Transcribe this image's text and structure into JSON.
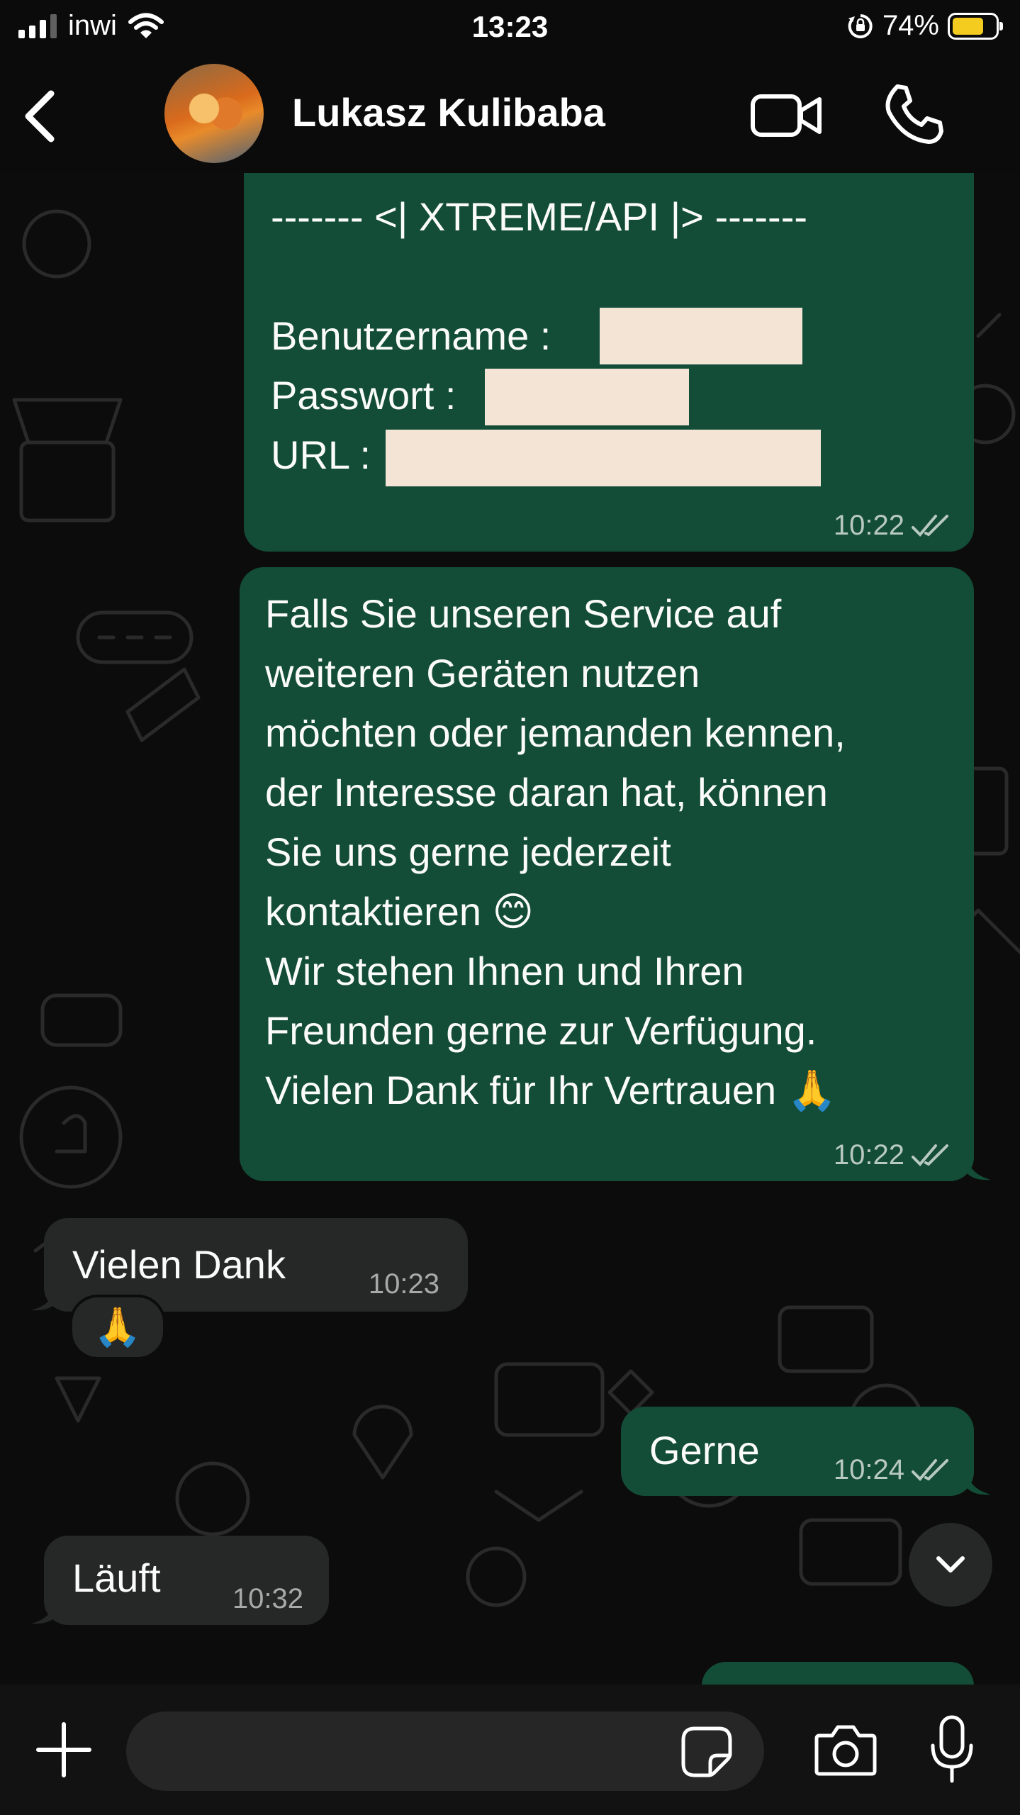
{
  "status_bar": {
    "carrier": "inwi",
    "time": "13:23",
    "battery": "74%",
    "battery_level": 0.74,
    "battery_color": "#f3cc1f"
  },
  "header": {
    "contact_name": "Lukasz Kulibaba"
  },
  "messages": [
    {
      "direction": "outgoing",
      "lines": [
        "------- <| XTREME/API |> -------",
        "",
        "Benutzername : ",
        "Passwort : ",
        "URL : "
      ],
      "time": "10:22",
      "read": true
    },
    {
      "direction": "outgoing",
      "text": "Falls Sie unseren Service auf\nweiteren Geräten nutzen\nmöchten oder jemanden kennen,\nder Interesse daran hat, können\nSie uns gerne jederzeit\nkontaktieren 😊\nWir stehen Ihnen und Ihren\nFreunden gerne zur Verfügung.\nVielen Dank für Ihr Vertrauen 🙏",
      "time": "10:22",
      "read": true
    },
    {
      "direction": "incoming",
      "text": "Vielen Dank",
      "time": "10:23",
      "reaction": "🙏"
    },
    {
      "direction": "outgoing",
      "text": "Gerne",
      "time": "10:24",
      "read": true
    },
    {
      "direction": "incoming",
      "text": "Läuft",
      "time": "10:32"
    }
  ],
  "colors": {
    "outgoing_bubble": "#134d37",
    "incoming_bubble": "#262727",
    "redaction": "#f3e4d6"
  },
  "icons": [
    "back-icon",
    "video-call-icon",
    "voice-call-icon",
    "double-check-icon",
    "chevron-down-icon",
    "plus-icon",
    "sticker-icon",
    "camera-icon",
    "microphone-icon"
  ],
  "composer": {
    "placeholder": ""
  }
}
